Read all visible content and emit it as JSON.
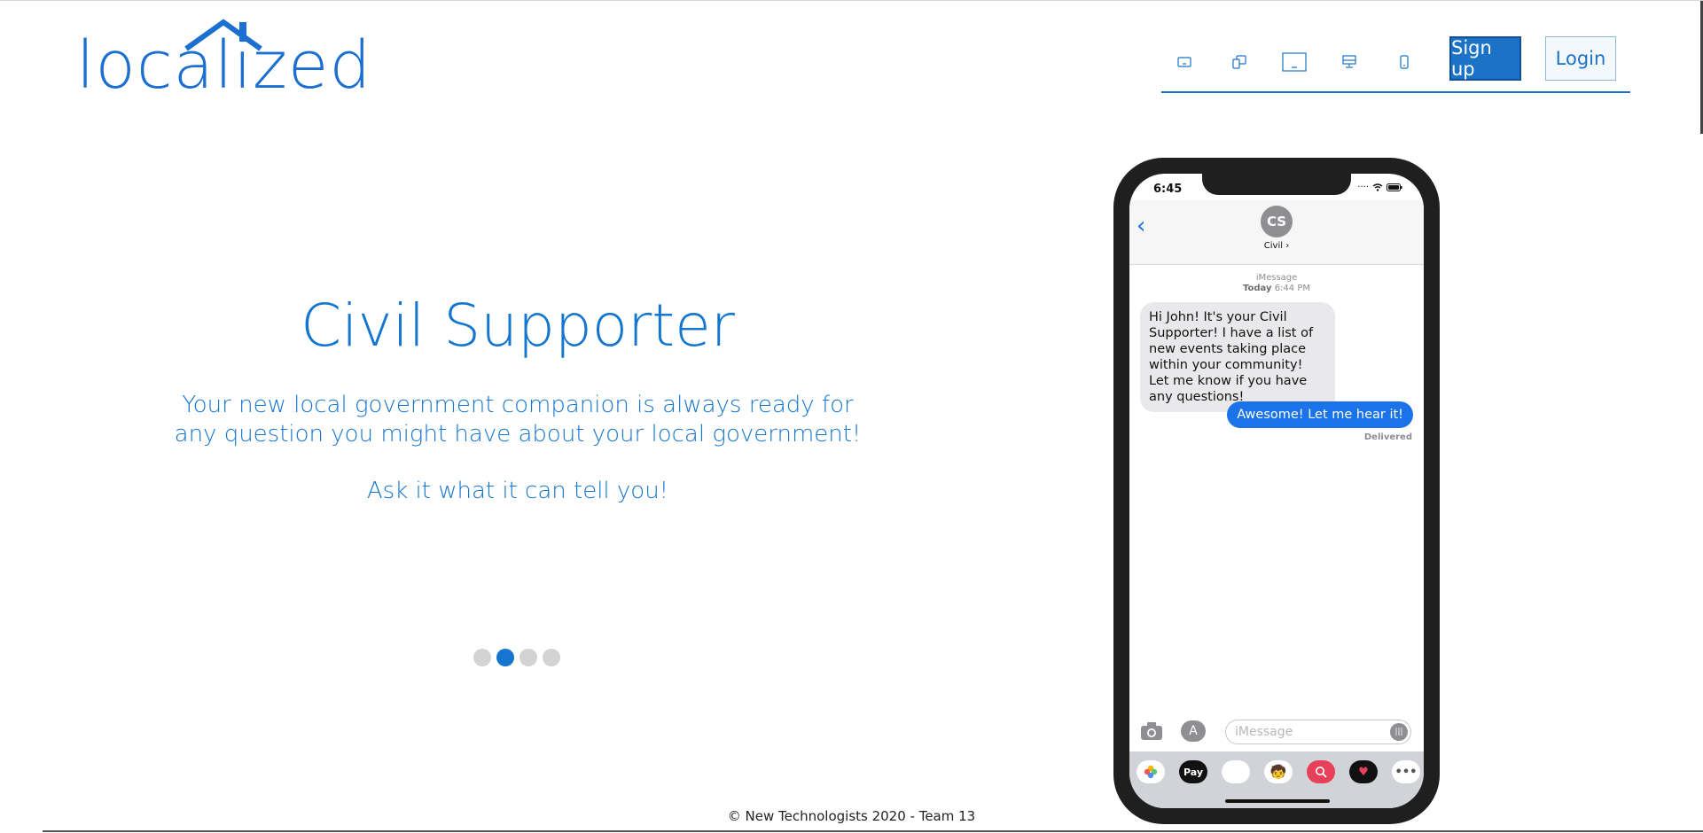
{
  "brand": {
    "name": "localized",
    "color": "#1a6fd1"
  },
  "nav": {
    "icons": [
      "small-screen-icon",
      "copy-device-icon",
      "laptop-icon",
      "desktop-icon",
      "mobile-icon"
    ],
    "signup_label": "Sign up",
    "login_label": "Login"
  },
  "hero": {
    "title": "Civil Supporter",
    "subtitle_line1": "Your new local government companion is always ready for",
    "subtitle_line2": "any question you might have about your local government!",
    "cta": "Ask it what it can tell you!",
    "carousel": {
      "total": 4,
      "active_index": 1
    }
  },
  "phone": {
    "time": "6:45",
    "avatar_initials": "CS",
    "contact_name": "Civil",
    "imessage_label": "iMessage",
    "day": "Today",
    "timestamp": "6:44 PM",
    "incoming_message": "Hi John! It's your Civil Supporter! I have a list of new events taking place within your community! Let me know if you have any questions!",
    "outgoing_message": "Awesome! Let me hear it!",
    "delivered": "Delivered",
    "input_placeholder": "iMessage",
    "apple_pay": "Pay"
  },
  "footer": {
    "text": "© New Technologists 2020 - Team 13"
  }
}
